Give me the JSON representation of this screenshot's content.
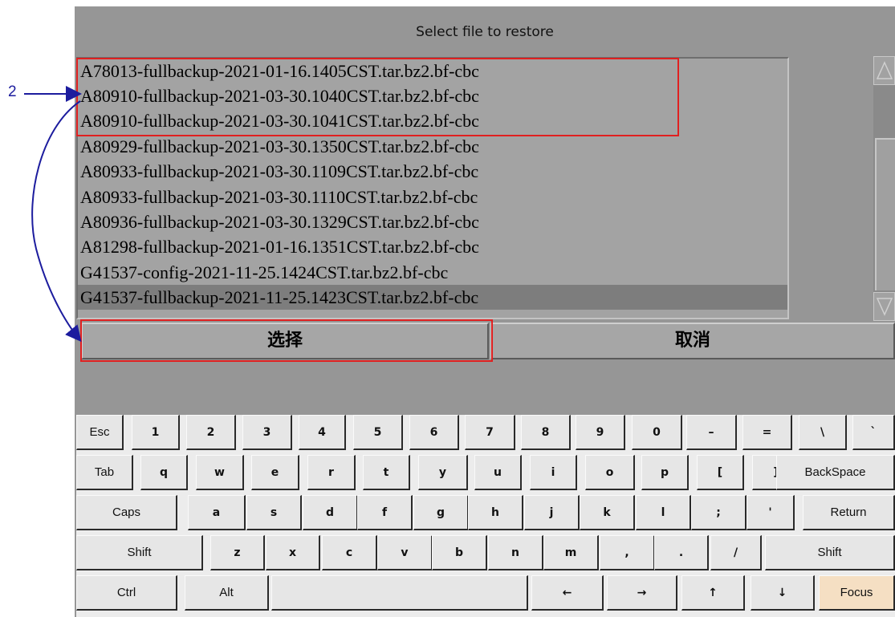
{
  "dialog": {
    "title": "Select file to restore",
    "files": [
      "A78013-fullbackup-2021-01-16.1405CST.tar.bz2.bf-cbc",
      "A80910-fullbackup-2021-03-30.1040CST.tar.bz2.bf-cbc",
      "A80910-fullbackup-2021-03-30.1041CST.tar.bz2.bf-cbc",
      "A80929-fullbackup-2021-03-30.1350CST.tar.bz2.bf-cbc",
      "A80933-fullbackup-2021-03-30.1109CST.tar.bz2.bf-cbc",
      "A80933-fullbackup-2021-03-30.1110CST.tar.bz2.bf-cbc",
      "A80936-fullbackup-2021-03-30.1329CST.tar.bz2.bf-cbc",
      "A81298-fullbackup-2021-01-16.1351CST.tar.bz2.bf-cbc",
      "G41537-config-2021-11-25.1424CST.tar.bz2.bf-cbc",
      "G41537-fullbackup-2021-11-25.1423CST.tar.bz2.bf-cbc"
    ],
    "selected_index": 9,
    "select_label": "选择",
    "cancel_label": "取消"
  },
  "annotation": {
    "step_number": "2",
    "color": "#1c1c9e",
    "highlight_color": "#e02020"
  },
  "keyboard": {
    "rows": [
      [
        "Esc",
        "1",
        "2",
        "3",
        "4",
        "5",
        "6",
        "7",
        "8",
        "9",
        "0",
        "–",
        "=",
        "\\",
        "`"
      ],
      [
        "Tab",
        "q",
        "w",
        "e",
        "r",
        "t",
        "y",
        "u",
        "i",
        "o",
        "p",
        "[",
        "]",
        "BackSpace"
      ],
      [
        "Caps",
        "a",
        "s",
        "d",
        "f",
        "g",
        "h",
        "j",
        "k",
        "l",
        ";",
        "'",
        "Return"
      ],
      [
        "Shift",
        "z",
        "x",
        "c",
        "v",
        "b",
        "n",
        "m",
        ",",
        ".",
        "/",
        "Shift"
      ],
      [
        "Ctrl",
        "Alt",
        "",
        "←",
        "→",
        "↑",
        "↓",
        "Focus"
      ]
    ],
    "focus_key_color": "#f5dfc3"
  }
}
